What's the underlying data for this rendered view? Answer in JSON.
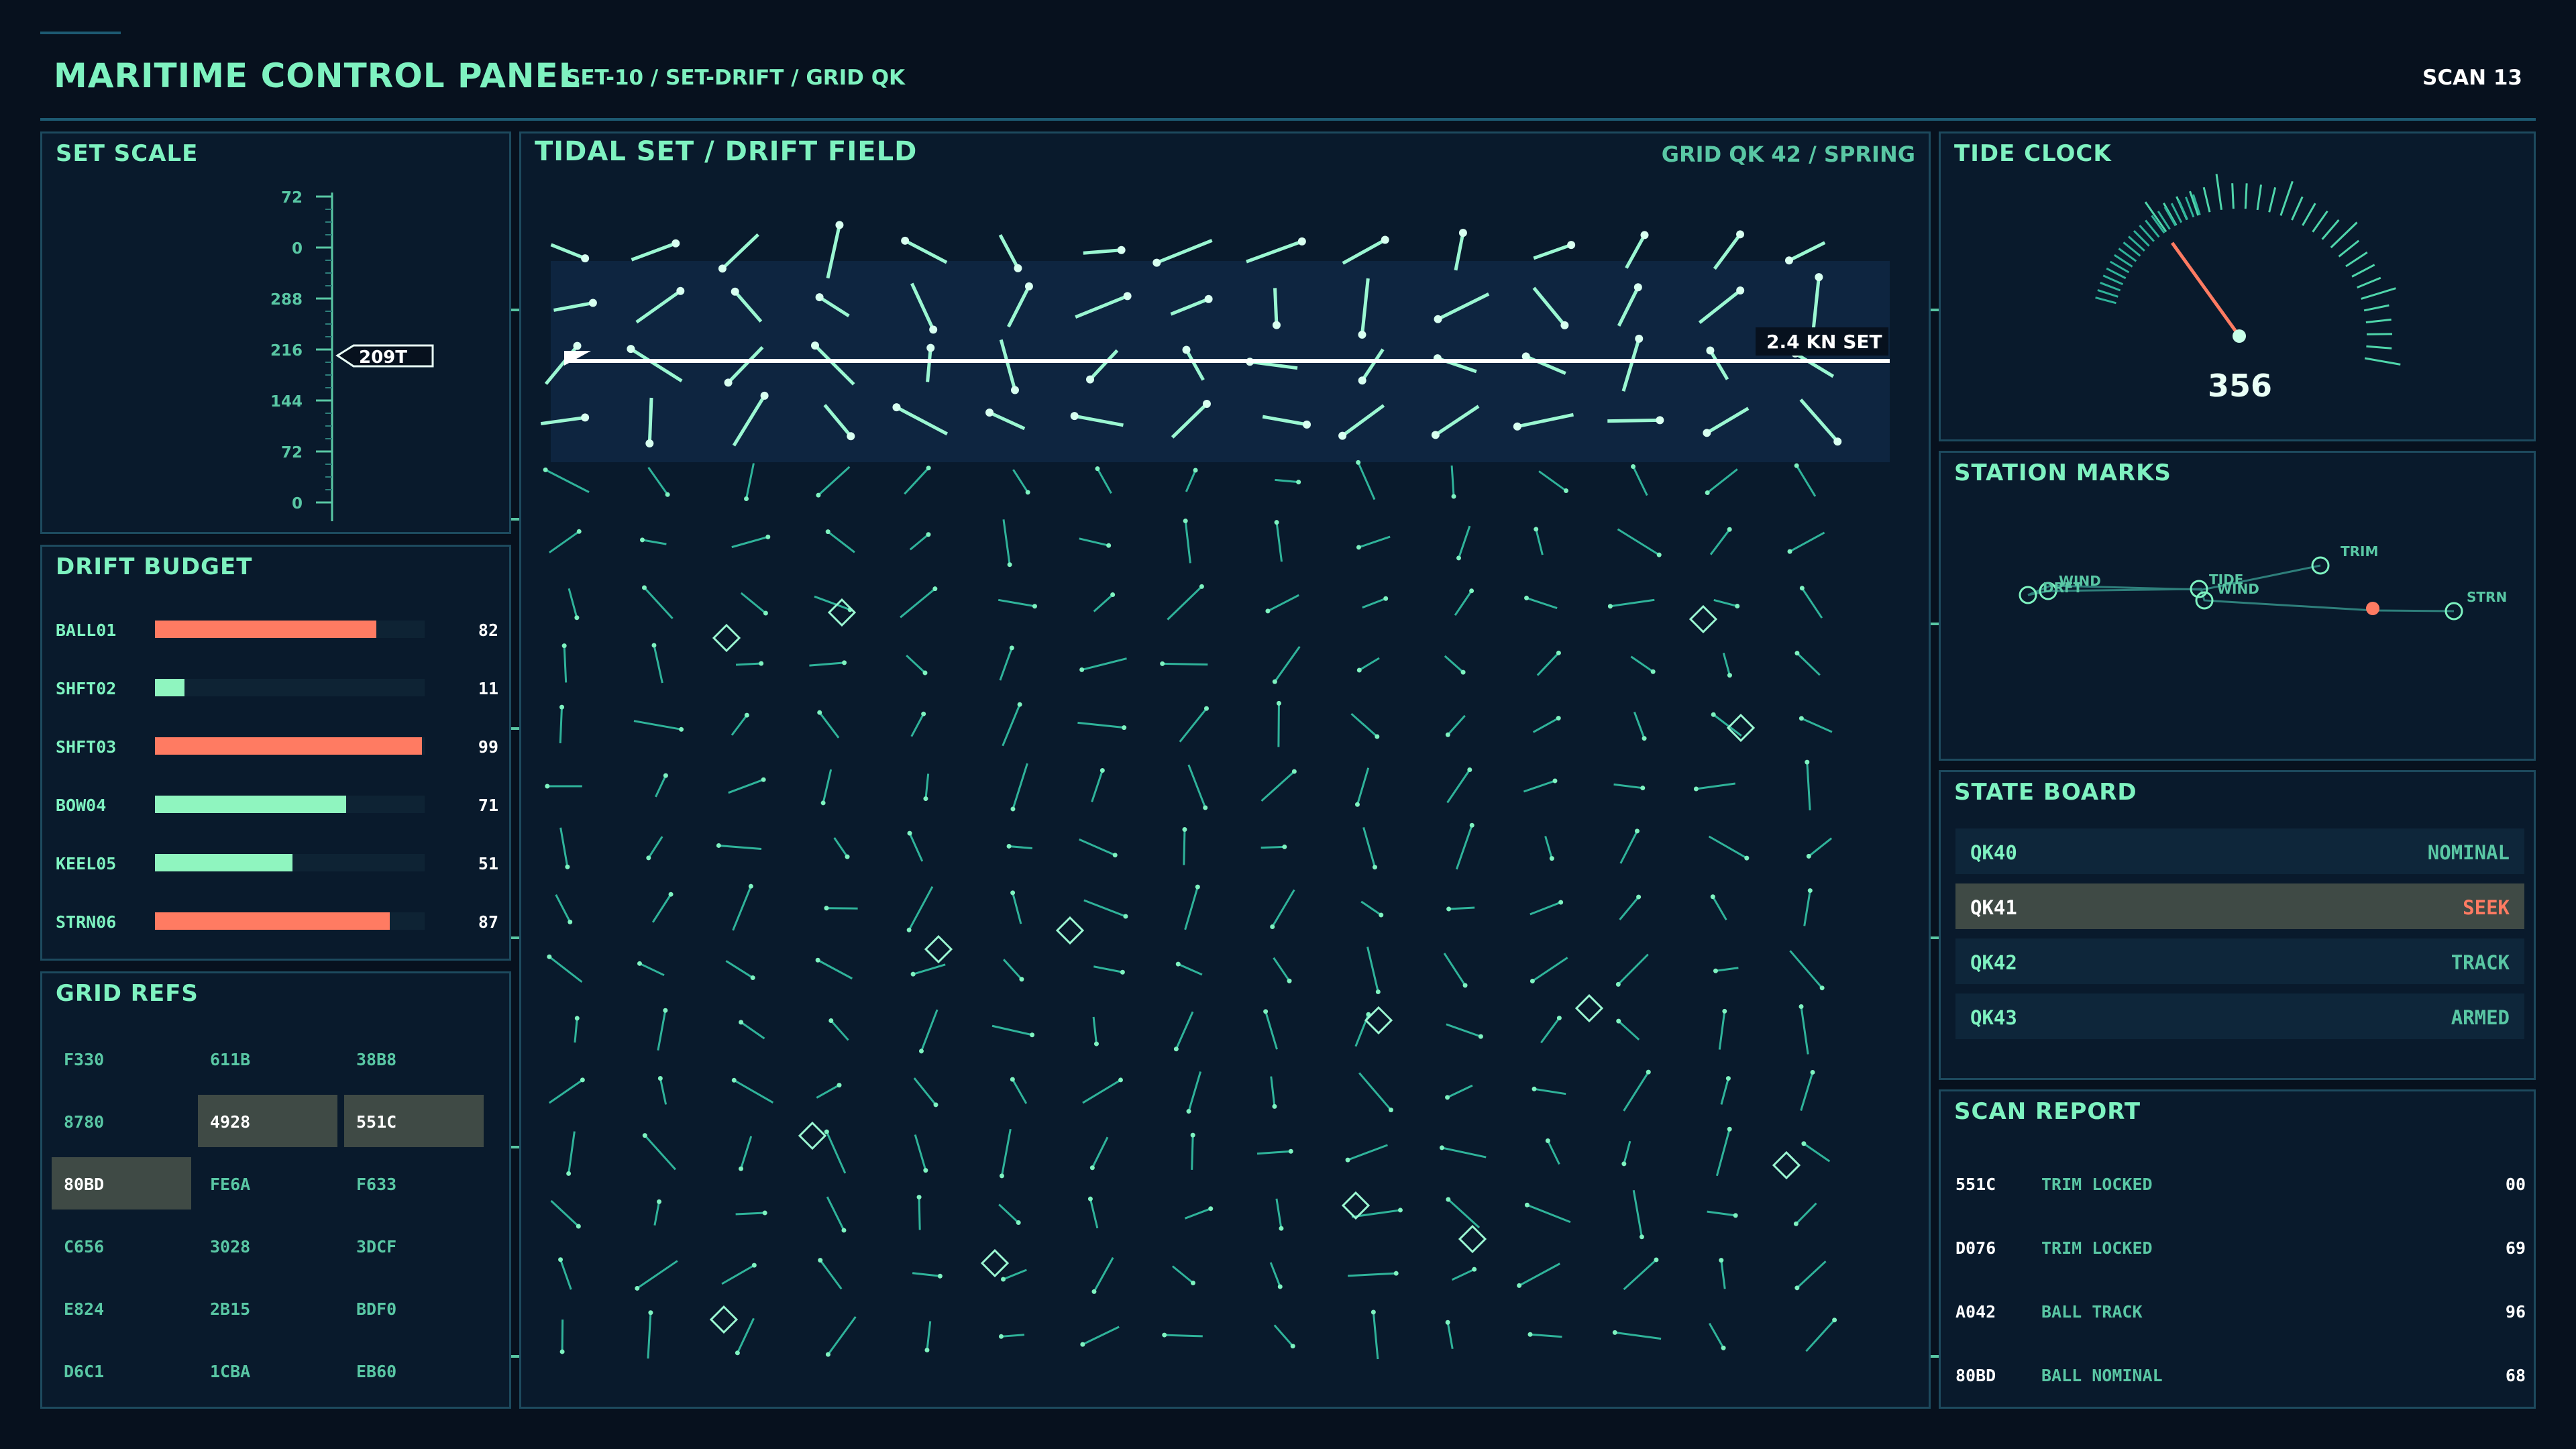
{
  "header": {
    "title": "MARITIME CONTROL PANEL",
    "breadcrumb": "SET-10 / SET-DRIFT / GRID QK",
    "scan": "SCAN 13"
  },
  "set_scale": {
    "title": "SET SCALE",
    "ticks": [
      "72",
      "0",
      "288",
      "216",
      "144",
      "72",
      "0"
    ],
    "marker": "209T"
  },
  "drift_budget": {
    "title": "DRIFT BUDGET",
    "rows": [
      {
        "label": "BALL01",
        "value": 82,
        "display": "82",
        "color": "#ff7b62"
      },
      {
        "label": "SHFT02",
        "value": 11,
        "display": "11",
        "color": "#8ff5bf"
      },
      {
        "label": "SHFT03",
        "value": 99,
        "display": "99",
        "color": "#ff7b62"
      },
      {
        "label": "BOW04",
        "value": 71,
        "display": "71",
        "color": "#8ff5bf"
      },
      {
        "label": "KEEL05",
        "value": 51,
        "display": "51",
        "color": "#8ff5bf"
      },
      {
        "label": "STRN06",
        "value": 87,
        "display": "87",
        "color": "#ff7b62"
      }
    ]
  },
  "grid_refs": {
    "title": "GRID REFS",
    "cells": [
      [
        "F330",
        "611B",
        "38B8"
      ],
      [
        "8780",
        "4928",
        "551C"
      ],
      [
        "80BD",
        "FE6A",
        "F633"
      ],
      [
        "C656",
        "3028",
        "3DCF"
      ],
      [
        "E824",
        "2B15",
        "BDF0"
      ],
      [
        "D6C1",
        "1CBA",
        "EB60"
      ]
    ],
    "highlighted": [
      "4928",
      "551C",
      "80BD"
    ]
  },
  "field": {
    "title": "TIDAL SET / DRIFT FIELD",
    "subtitle": "GRID QK 42 / SPRING",
    "set_label": "2.4 KN SET"
  },
  "tide_clock": {
    "title": "TIDE CLOCK",
    "value": "356"
  },
  "station_marks": {
    "title": "STATION MARKS",
    "labels": [
      "WIND",
      "DRFT",
      "TIDE",
      "WIND",
      "TRIM",
      "STRN"
    ]
  },
  "state_board": {
    "title": "STATE BOARD",
    "rows": [
      {
        "key": "QK40",
        "state": "NOMINAL"
      },
      {
        "key": "QK41",
        "state": "SEEK",
        "highlight": true
      },
      {
        "key": "QK42",
        "state": "TRACK"
      },
      {
        "key": "QK43",
        "state": "ARMED"
      }
    ]
  },
  "scan_report": {
    "title": "SCAN REPORT",
    "rows": [
      {
        "id": "551C",
        "msg": "TRIM LOCKED",
        "num": "00"
      },
      {
        "id": "D076",
        "msg": "TRIM LOCKED",
        "num": "69"
      },
      {
        "id": "A042",
        "msg": "BALL TRACK",
        "num": "96"
      },
      {
        "id": "80BD",
        "msg": "BALL NOMINAL",
        "num": "68"
      }
    ]
  },
  "colors": {
    "accent": "#7ef2c0",
    "alert": "#ff7b62",
    "panel": "#091a2c",
    "border": "#1d4a5e"
  }
}
